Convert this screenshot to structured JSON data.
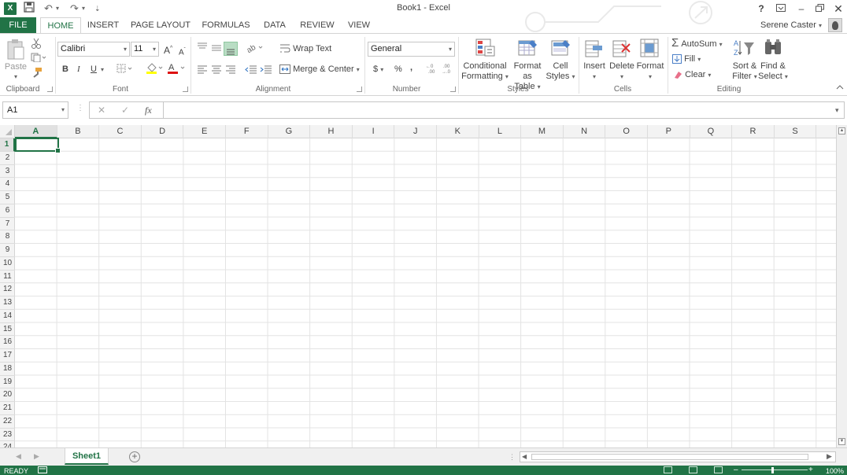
{
  "app": {
    "title": "Book1 - Excel",
    "logo": "X",
    "quick_access": [
      "save-icon",
      "undo-icon",
      "redo-icon",
      "customize-icon"
    ]
  },
  "window_controls": {
    "help": "?",
    "ribbon_display": "ribbon-display-options-icon",
    "minimize": "minimize-icon",
    "restore": "restore-icon",
    "close": "close-icon"
  },
  "user": {
    "name": "Serene Caster"
  },
  "tabs": [
    {
      "label": "FILE"
    },
    {
      "label": "HOME"
    },
    {
      "label": "INSERT"
    },
    {
      "label": "PAGE LAYOUT"
    },
    {
      "label": "FORMULAS"
    },
    {
      "label": "DATA"
    },
    {
      "label": "REVIEW"
    },
    {
      "label": "VIEW"
    }
  ],
  "ribbon": {
    "clipboard": {
      "label": "Clipboard",
      "paste": "Paste"
    },
    "font": {
      "label": "Font",
      "font_name": "Calibri",
      "font_size": "11",
      "bold": "B",
      "italic": "I",
      "underline": "U",
      "grow": "A",
      "shrink": "A"
    },
    "alignment": {
      "label": "Alignment",
      "wrap_text": "Wrap Text",
      "merge_center": "Merge & Center"
    },
    "number": {
      "label": "Number",
      "format": "General",
      "currency": "$",
      "percent": "%",
      "comma": ","
    },
    "styles": {
      "label": "Styles",
      "conditional_1": "Conditional",
      "conditional_2": "Formatting",
      "format_as_1": "Format as",
      "format_as_2": "Table",
      "cell_styles_1": "Cell",
      "cell_styles_2": "Styles"
    },
    "cells": {
      "label": "Cells",
      "insert": "Insert",
      "delete": "Delete",
      "format": "Format"
    },
    "editing": {
      "label": "Editing",
      "autosum": "AutoSum",
      "fill": "Fill",
      "clear": "Clear",
      "sort_1": "Sort &",
      "sort_2": "Filter",
      "find_1": "Find &",
      "find_2": "Select"
    }
  },
  "formula_bar": {
    "name_box": "A1",
    "cancel": "✕",
    "enter": "✓",
    "fx": "fx",
    "value": ""
  },
  "grid": {
    "columns": [
      "A",
      "B",
      "C",
      "D",
      "E",
      "F",
      "G",
      "H",
      "I",
      "J",
      "K",
      "L",
      "M",
      "N",
      "O",
      "P",
      "Q",
      "R",
      "S"
    ],
    "rows": [
      "1",
      "2",
      "3",
      "4",
      "5",
      "6",
      "7",
      "8",
      "9",
      "10",
      "11",
      "12",
      "13",
      "14",
      "15",
      "16",
      "17",
      "18",
      "19",
      "20",
      "21",
      "22",
      "23",
      "24"
    ],
    "selected_cell": "A1"
  },
  "sheets": [
    {
      "label": "Sheet1",
      "active": true
    }
  ],
  "status": {
    "ready": "READY",
    "zoom": "100%"
  },
  "colors": {
    "accent": "#217346"
  }
}
